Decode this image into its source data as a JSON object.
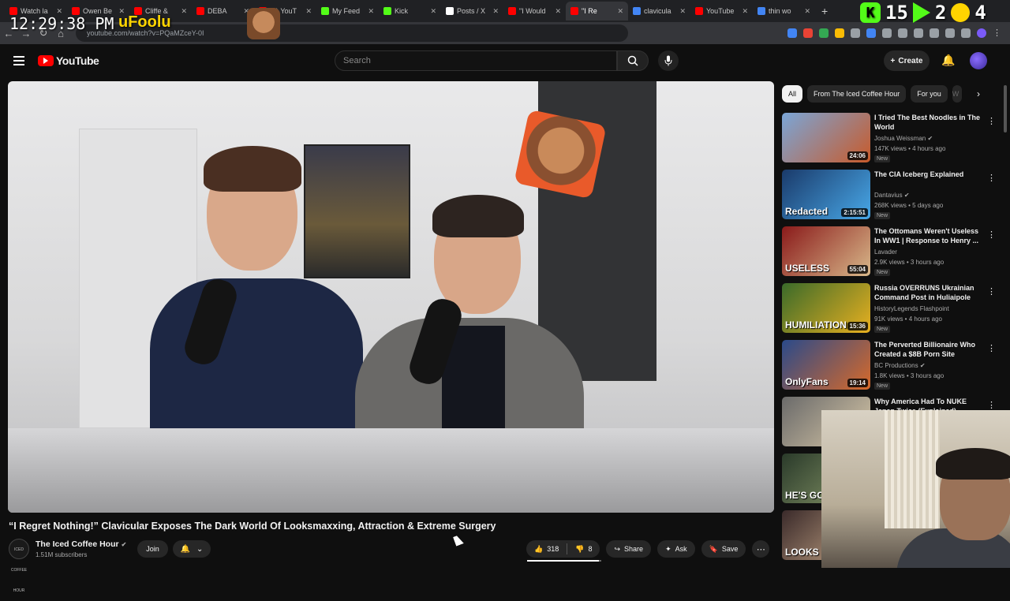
{
  "browser": {
    "tabs": [
      {
        "label": "Watch la",
        "color": "#ff0000"
      },
      {
        "label": "Owen Be",
        "color": "#ff0000"
      },
      {
        "label": "Cliffe &",
        "color": "#ff0000"
      },
      {
        "label": "DEBA",
        "color": "#ff0000"
      },
      {
        "label": "(2) YouT",
        "color": "#ff0000"
      },
      {
        "label": "My Feed",
        "color": "#53fc18"
      },
      {
        "label": "Kick",
        "color": "#53fc18"
      },
      {
        "label": "Posts / X",
        "color": "#ffffff"
      },
      {
        "label": "\"I Would",
        "color": "#ff0000"
      },
      {
        "label": "\"I Re",
        "color": "#ff0000",
        "active": true
      },
      {
        "label": "clavicula",
        "color": "#4285f4"
      },
      {
        "label": "YouTube",
        "color": "#ff0000"
      },
      {
        "label": "thin wo",
        "color": "#4285f4"
      }
    ],
    "tab_close": "✕",
    "new_tab": "+",
    "url": "youtube.com/watch?v=PQaMZceY-0I"
  },
  "overlay": {
    "clock": "12:29:38 PM",
    "name": "uFoolu",
    "score_left": "15",
    "score_mid": "2",
    "score_right": "4",
    "kick_letter": "K"
  },
  "youtube": {
    "logo_text": "YouTube",
    "search_placeholder": "Search",
    "create_label": "Create"
  },
  "video": {
    "title": "“I Regret Nothing!” Clavicular Exposes The Dark World Of Looksmaxxing, Attraction & Extreme Surgery",
    "channel": "The Iced Coffee Hour",
    "channel_avatar_text": "ICED COFFEE HOUR",
    "subscribers": "1.51M subscribers",
    "join_label": "Join",
    "likes": "318",
    "dislikes": "8",
    "like_ratio": 0.97,
    "share_label": "Share",
    "ask_label": "Ask",
    "save_label": "Save"
  },
  "chips": [
    "All",
    "From The Iced Coffee Hour",
    "For you",
    "W"
  ],
  "recommendations": [
    {
      "title": "I Tried The Best Noodles in The World",
      "channel": "Joshua Weissman",
      "meta": "147K views • 4 hours ago",
      "badge": "New",
      "duration": "24:06",
      "thumb_text": "",
      "verified": true
    },
    {
      "title": "The CIA Iceberg Explained",
      "channel": "Dantavius",
      "meta": "268K views • 5 days ago",
      "badge": "New",
      "duration": "2:15:51",
      "thumb_text": "Redacted",
      "verified": true
    },
    {
      "title": "The Ottomans Weren't Useless In WW1 | Response to Henry ...",
      "channel": "Lavader",
      "meta": "2.9K views • 3 hours ago",
      "badge": "New",
      "duration": "55:04",
      "thumb_text": "USELESS",
      "verified": false
    },
    {
      "title": "Russia OVERRUNS Ukrainian Command Post in Huliaipole",
      "channel": "HistoryLegends Flashpoint",
      "meta": "91K views • 4 hours ago",
      "badge": "New",
      "duration": "15:36",
      "thumb_text": "HUMILIATION",
      "verified": false
    },
    {
      "title": "The Perverted Billionaire Who Created a $8B Porn Site",
      "channel": "BC Productions",
      "meta": "1.8K views • 3 hours ago",
      "badge": "New",
      "duration": "19:14",
      "thumb_text": "OnlyFans",
      "verified": true
    },
    {
      "title": "Why America Had To NUKE Japan Twice (Explained)",
      "channel": "",
      "meta": "",
      "badge": "",
      "duration": "",
      "thumb_text": "",
      "verified": false
    },
    {
      "title": "",
      "channel": "",
      "meta": "",
      "badge": "",
      "duration": "",
      "thumb_text": "HE'S GOIN",
      "verified": false
    },
    {
      "title": "",
      "channel": "",
      "meta": "",
      "badge": "",
      "duration": "",
      "thumb_text": "LOOKS",
      "verified": false
    }
  ],
  "colors": {
    "accent": "#ff0000",
    "background": "#0f0f0f",
    "kick": "#53fc18"
  }
}
